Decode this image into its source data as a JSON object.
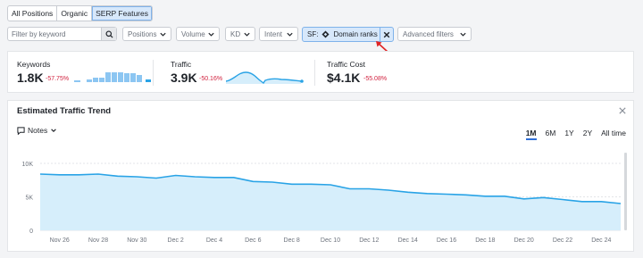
{
  "tabs": [
    {
      "label": "All Positions",
      "active": false
    },
    {
      "label": "Organic",
      "active": false
    },
    {
      "label": "SERP Features",
      "active": true
    }
  ],
  "filters": {
    "search_placeholder": "Filter by keyword",
    "dropdowns": [
      "Positions",
      "Volume",
      "KD",
      "Intent"
    ],
    "sf_chip": {
      "prefix": "SF:",
      "icon": "diamond-icon",
      "value": "Domain ranks"
    },
    "advanced": "Advanced filters"
  },
  "metrics": [
    {
      "name": "Keywords",
      "value": "1.8K",
      "change": "-57.75%",
      "spark": "bars"
    },
    {
      "name": "Traffic",
      "value": "3.9K",
      "change": "-50.16%",
      "spark": "area"
    },
    {
      "name": "Traffic Cost",
      "value": "$4.1K",
      "change": "-55.08%",
      "spark": "none"
    }
  ],
  "colors": {
    "accent": "#2e6ed6",
    "line": "#29a3e6",
    "fill": "#d6eefb",
    "negative": "#d1223f"
  },
  "trend": {
    "title": "Estimated Traffic Trend",
    "notes_label": "Notes",
    "ranges": [
      "1M",
      "6M",
      "1Y",
      "2Y",
      "All time"
    ],
    "selected_range": "1M"
  },
  "chart_data": {
    "type": "area",
    "title": "",
    "ylim": [
      0,
      10000
    ],
    "yticks": [
      "0",
      "5K",
      "10K"
    ],
    "xticks": [
      "Nov 26",
      "Nov 28",
      "Nov 30",
      "Dec 2",
      "Dec 4",
      "Dec 6",
      "Dec 8",
      "Dec 10",
      "Dec 12",
      "Dec 14",
      "Dec 16",
      "Dec 18",
      "Dec 20",
      "Dec 22",
      "Dec 24"
    ],
    "x": [
      "Nov 25",
      "Nov 26",
      "Nov 27",
      "Nov 28",
      "Nov 29",
      "Nov 30",
      "Dec 1",
      "Dec 2",
      "Dec 3",
      "Dec 4",
      "Dec 5",
      "Dec 6",
      "Dec 7",
      "Dec 8",
      "Dec 9",
      "Dec 10",
      "Dec 11",
      "Dec 12",
      "Dec 13",
      "Dec 14",
      "Dec 15",
      "Dec 16",
      "Dec 17",
      "Dec 18",
      "Dec 19",
      "Dec 20",
      "Dec 21",
      "Dec 22",
      "Dec 23",
      "Dec 24",
      "Dec 25"
    ],
    "series": [
      {
        "values": [
          8400,
          8300,
          8300,
          8400,
          8100,
          8000,
          7800,
          8200,
          8000,
          7900,
          7900,
          7300,
          7200,
          6900,
          6900,
          6800,
          6200,
          6200,
          6000,
          5700,
          5500,
          5400,
          5300,
          5100,
          5100,
          4700,
          4900,
          4600,
          4300,
          4300,
          4000
        ]
      }
    ]
  }
}
